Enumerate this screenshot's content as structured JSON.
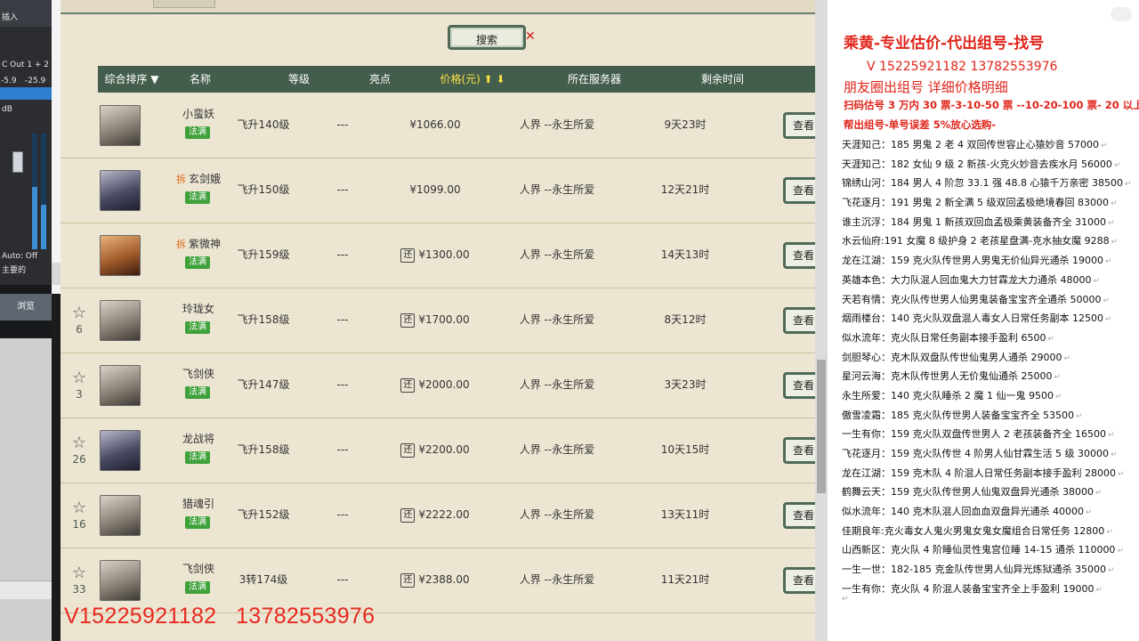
{
  "mixer": {
    "top_label": "插入",
    "out_label": "C Out 1 + 2",
    "db_left": "-5.9",
    "db_right": "-25.9",
    "db_unit": "dB",
    "auto_label": "Auto: Off",
    "main_label": "主要的"
  },
  "browse_label": "浏览",
  "game": {
    "search_label": "搜索",
    "search_close": "✕",
    "headers": {
      "sort": "综合排序 ▼",
      "name": "名称",
      "level": "等级",
      "highlight": "亮点",
      "price": "价格(元) ⬆ ⬇",
      "server": "所在服务器",
      "time_left": "剩余时间"
    },
    "rows": [
      {
        "star": "",
        "count": "",
        "name": "小蛮妖",
        "chai": "",
        "badge": "法满",
        "level": "飞升140级",
        "highlight": "---",
        "returnable": false,
        "price": "¥1066.00",
        "server": "人界 --永生所爱",
        "time": "9天23时",
        "view": "查看"
      },
      {
        "star": "",
        "count": "",
        "name": "玄剑娥",
        "chai": "拆",
        "badge": "法满",
        "level": "飞升150级",
        "highlight": "---",
        "returnable": false,
        "price": "¥1099.00",
        "server": "人界 --永生所爱",
        "time": "12天21时",
        "view": "查看"
      },
      {
        "star": "",
        "count": "",
        "name": "紫微神",
        "chai": "拆",
        "badge": "法满",
        "level": "飞升159级",
        "highlight": "---",
        "returnable": true,
        "price": "¥1300.00",
        "server": "人界 --永生所爱",
        "time": "14天13时",
        "view": "查看"
      },
      {
        "star": "☆",
        "count": "6",
        "name": "玲珑女",
        "chai": "",
        "badge": "法满",
        "level": "飞升158级",
        "highlight": "---",
        "returnable": true,
        "price": "¥1700.00",
        "server": "人界 --永生所爱",
        "time": "8天12时",
        "view": "查看"
      },
      {
        "star": "☆",
        "count": "3",
        "name": "飞剑侠",
        "chai": "",
        "badge": "法满",
        "level": "飞升147级",
        "highlight": "---",
        "returnable": true,
        "price": "¥2000.00",
        "server": "人界 --永生所爱",
        "time": "3天23时",
        "view": "查看"
      },
      {
        "star": "☆",
        "count": "26",
        "name": "龙战将",
        "chai": "",
        "badge": "法满",
        "level": "飞升158级",
        "highlight": "---",
        "returnable": true,
        "price": "¥2200.00",
        "server": "人界 --永生所爱",
        "time": "10天15时",
        "view": "查看"
      },
      {
        "star": "☆",
        "count": "16",
        "name": "猎魂引",
        "chai": "",
        "badge": "法满",
        "level": "飞升152级",
        "highlight": "---",
        "returnable": true,
        "price": "¥2222.00",
        "server": "人界 --永生所爱",
        "time": "13天11时",
        "view": "查看"
      },
      {
        "star": "☆",
        "count": "33",
        "name": "飞剑侠",
        "chai": "",
        "badge": "法满",
        "level": "3转174级",
        "highlight": "---",
        "returnable": true,
        "price": "¥2388.00",
        "server": "人界 --永生所爱",
        "time": "11天21时",
        "view": "查看"
      }
    ],
    "return_icon": "还"
  },
  "overlay_phone": "V15225921182   13782553976",
  "notepad": {
    "headline": "乘黄-专业估价-代出组号-找号",
    "contact": "V 15225921182   13782553976",
    "circle": "朋友圈出组号    详细价格明细",
    "price_info": "扫码估号 3 万内 30 票-3-10-50 票  --10-20-100 票- 20 以上 150",
    "help_info": "帮出组号-单号误差 5%放心选购-",
    "lines": [
      "天涯知己：185 男鬼 2 老 4 双回传世容止心猿妙音 57000",
      "天涯知己：182 女仙 9 级 2 新孩-火克火妙音去疾水月 56000",
      "锦绣山河：184 男人 4 阶忽 33.1 强 48.8 心猿千万亲密 38500",
      "飞花逐月：191 男鬼 2 新全满 5 级双回孟极绝境春回 83000",
      "谁主沉浮：184 男鬼 1 新孩双回血孟极乘黄装备齐全 31000",
      "水云仙府:191 女魔 8 级护身 2 老孩星盘满-克水抽女魔 9288",
      "龙在江湖：159 克火队传世男人男鬼无价仙异光通杀 19000",
      "英雄本色：大力队混人回血鬼大力甘霖龙大力通杀 48000",
      "天若有情：克火队传世男人仙男鬼装备宝宝齐全通杀 50000",
      "烟雨楼台：140 克火队双盘混人毒女人日常任务副本 12500",
      "似水流年：克火队日常任务副本接手盈利 6500",
      "剑胆琴心：克木队双盘队传世仙鬼男人通杀 29000",
      "星河云海：克木队传世男人无价鬼仙通杀 25000",
      "永生所爱：140 克火队睡杀 2 魔 1 仙一鬼 9500",
      "傲雪凌霜：185 克火队传世男人装备宝宝齐全 53500",
      "一生有你：159 克火队双盘传世男人 2 老孩装备齐全 16500",
      "飞花逐月：159 克火队传世 4 阶男人仙甘霖生活 5 级 30000",
      "龙在江湖：159 克木队 4 阶混人日常任务副本接手盈利 28000",
      "鹤舞云天：159 克火队传世男人仙鬼双盘异光通杀 38000",
      "似水流年：140 克木队混人回血血双盘异光通杀 40000",
      "佳期良年:克火毒女人鬼火男鬼女鬼女魔组合日常任务 12800",
      "山西新区：克火队 4 阶睡仙灵性鬼宫位睡 14-15 通杀 110000",
      "一生一世：182-185 克金队传世男人仙异光炼狱通杀 35000",
      "一生有你：克火队 4 阶混人装备宝宝齐全上手盈利 19000"
    ],
    "paragraph_mark": "↵"
  },
  "colors": {
    "header_bg": "#435e4c",
    "accent_red": "#e0251b",
    "badge_green": "#3ea13a"
  }
}
